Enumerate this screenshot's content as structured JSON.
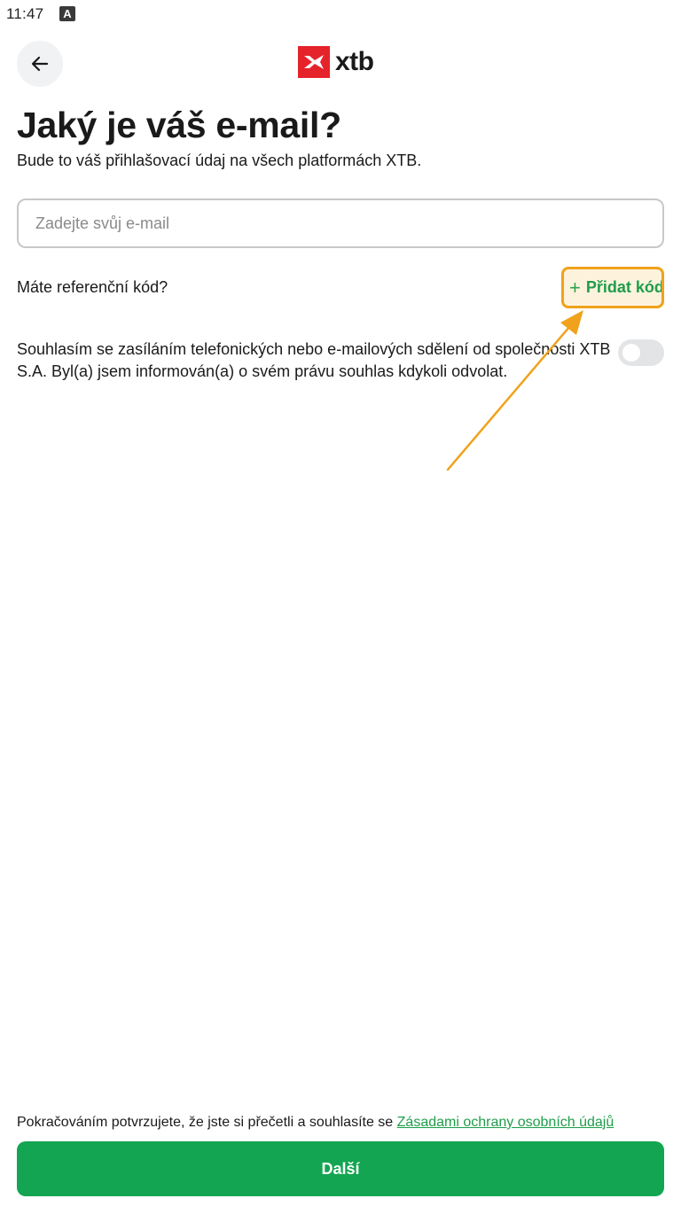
{
  "status_bar": {
    "time": "11:47",
    "indicator": "A"
  },
  "header": {
    "back_icon": "arrow-left-icon",
    "logo_text": "xtb",
    "logo_color": "#e5232a"
  },
  "main": {
    "title": "Jaký je váš e-mail?",
    "subtitle": "Bude to váš přihlašovací údaj na všech platformách XTB.",
    "email_input": {
      "value": "",
      "placeholder": "Zadejte svůj e-mail"
    },
    "referral": {
      "question": "Máte referenční kód?",
      "add_label": "Přidat kód",
      "add_icon": "plus-icon"
    },
    "consent": {
      "text": "Souhlasím se zasíláním telefonických nebo e-mailových sdělení od společnosti XTB S.A. Byl(a) jsem informován(a) o svém právu souhlas kdykoli odvolat.",
      "toggle_on": false
    }
  },
  "footer": {
    "note_prefix": "Pokračováním potvrzujete, že jste si přečetli a souhlasíte se ",
    "note_link": "Zásadami ochrany osobních údajů",
    "next_label": "Další"
  },
  "colors": {
    "accent_green": "#13a551",
    "highlight_orange": "#f0a21c",
    "brand_red": "#e5232a"
  }
}
